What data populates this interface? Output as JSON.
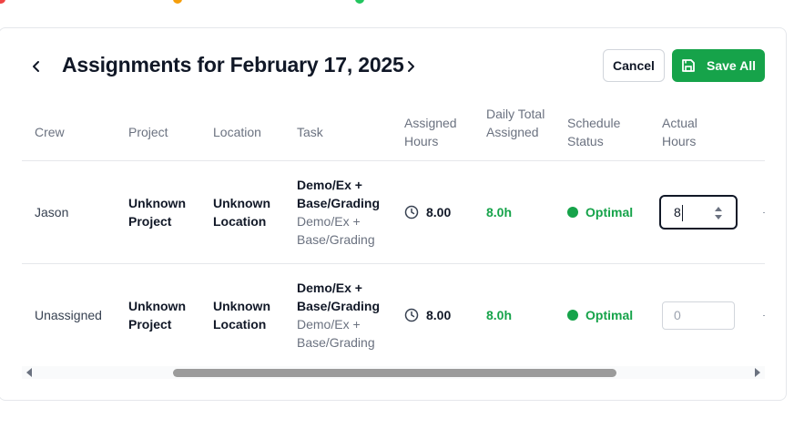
{
  "page": {
    "title": "Assignments for February 17, 2025",
    "cancel_label": "Cancel",
    "save_label": "Save All"
  },
  "legend_colors": [
    "#ef4444",
    "#f59e0b",
    "#22c55e"
  ],
  "columns": [
    "Crew",
    "Project",
    "Location",
    "Task",
    "Assigned Hours",
    "Daily Total Assigned",
    "Schedule Status",
    "Actual Hours"
  ],
  "rows": [
    {
      "crew": "Jason",
      "project": "Unknown Project",
      "location": "Unknown Location",
      "task_title": "Demo/Ex + Base/Grading",
      "task_sub": "Demo/Ex + Base/Grading",
      "assigned_hours": "8.00",
      "daily_total": "8.0h",
      "status": "Optimal",
      "actual_hours": "8"
    },
    {
      "crew": "Unassigned",
      "project": "Unknown Project",
      "location": "Unknown Location",
      "task_title": "Demo/Ex + Base/Grading",
      "task_sub": "Demo/Ex + Base/Grading",
      "assigned_hours": "8.00",
      "daily_total": "8.0h",
      "status": "Optimal",
      "actual_hours_placeholder": "0"
    }
  ],
  "colors": {
    "accent": "#16a34a",
    "status_optimal": "#16a34a",
    "border": "#e5e7eb"
  },
  "icons": [
    "chevron-left-icon",
    "chevron-right-icon",
    "save-icon",
    "clock-icon",
    "status-dot",
    "spinner-arrows-icon",
    "scroll-left-icon",
    "scroll-right-icon"
  ]
}
